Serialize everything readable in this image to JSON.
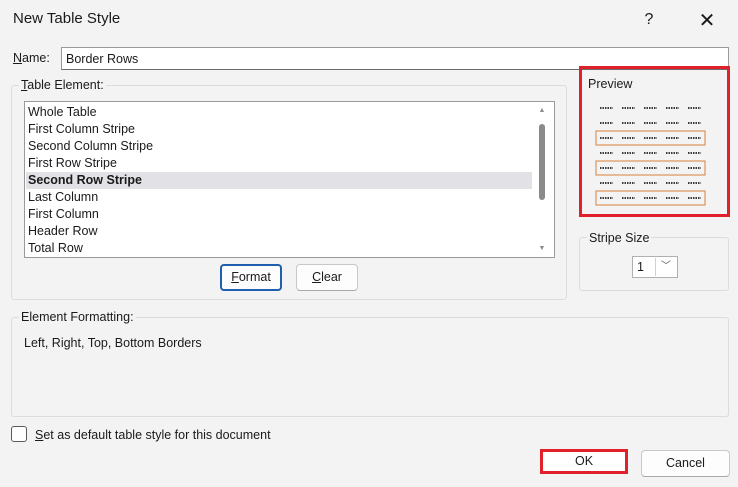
{
  "window": {
    "title": "New Table Style",
    "help": "?",
    "close": "✕"
  },
  "name": {
    "label_underlined": "N",
    "label_rest": "ame:",
    "value": "Border Rows"
  },
  "table_element": {
    "label_underlined": "T",
    "label_rest": "able Element:",
    "items": [
      {
        "label": "Whole Table",
        "selected": false
      },
      {
        "label": "First Column Stripe",
        "selected": false
      },
      {
        "label": "Second Column Stripe",
        "selected": false
      },
      {
        "label": "First Row Stripe",
        "selected": false
      },
      {
        "label": "Second Row Stripe",
        "selected": true
      },
      {
        "label": "Last Column",
        "selected": false
      },
      {
        "label": "First Column",
        "selected": false
      },
      {
        "label": "Header Row",
        "selected": false
      },
      {
        "label": "Total Row",
        "selected": false
      }
    ],
    "format_underlined": "F",
    "format_rest": "ormat",
    "clear_underlined": "C",
    "clear_rest": "lear"
  },
  "preview": {
    "label": "Preview",
    "accent_color": "#e0202a",
    "border_color": "#d9823a"
  },
  "stripe_size": {
    "label": "Stripe Size",
    "value": "1"
  },
  "element_formatting": {
    "label": "Element Formatting:",
    "value": "Left, Right, Top, Bottom Borders"
  },
  "default": {
    "label_underlined": "S",
    "label_rest": "et as default table style for this document",
    "checked": false
  },
  "buttons": {
    "ok": "OK",
    "cancel": "Cancel"
  }
}
